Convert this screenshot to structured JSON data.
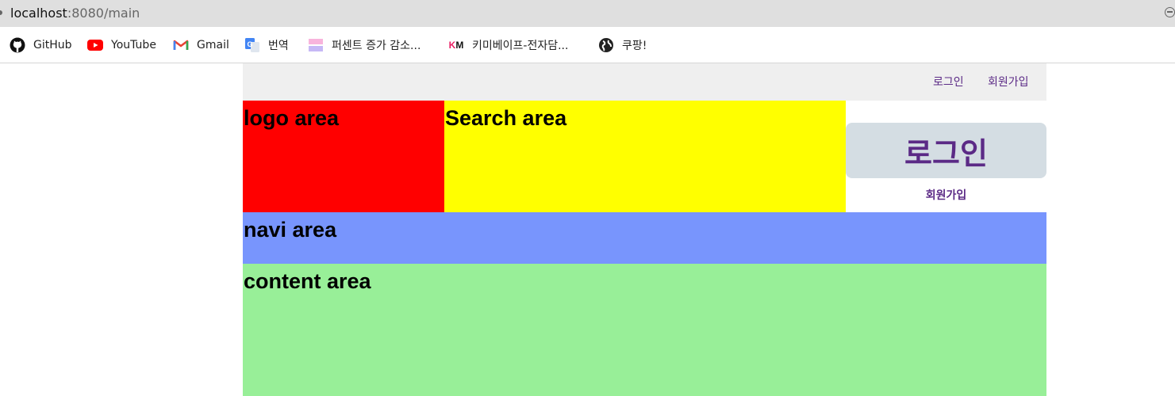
{
  "browser": {
    "url_host": "localhost",
    "url_rest": ":8080/main",
    "bookmarks": [
      {
        "label": "GitHub",
        "icon": "github-icon"
      },
      {
        "label": "YouTube",
        "icon": "youtube-icon"
      },
      {
        "label": "Gmail",
        "icon": "gmail-icon"
      },
      {
        "label": "번역",
        "icon": "translate-icon"
      },
      {
        "label": "퍼센트 증가 감소...",
        "icon": "percent-icon"
      },
      {
        "label": "키미베이프-전자담...",
        "icon": "km-icon"
      },
      {
        "label": "쿠팡!",
        "icon": "globe-icon"
      }
    ]
  },
  "header": {
    "login_link": "로그인",
    "join_link": "회원가입"
  },
  "areas": {
    "logo": "logo area",
    "search": "Search area",
    "navi": "navi area",
    "content": "content area"
  },
  "login_box": {
    "login_button": "로그인",
    "join_link": "회원가입"
  },
  "colors": {
    "logo_bg": "#ff0000",
    "search_bg": "#ffff00",
    "navi_bg": "#7895fd",
    "content_bg": "#98ef98",
    "link": "#5b2a86"
  }
}
